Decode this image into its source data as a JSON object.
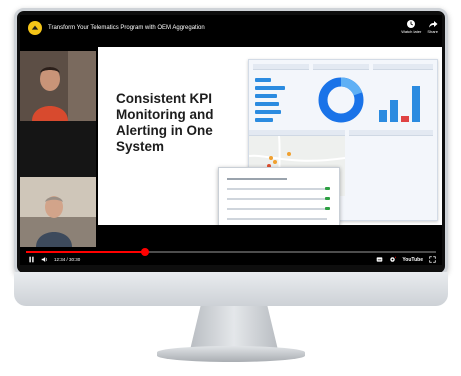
{
  "video": {
    "title": "Transform Your Telematics Program with OEM Aggregation",
    "time_current": "12:34",
    "time_total": "30:30",
    "progress_fraction": 0.29
  },
  "top_actions": [
    {
      "icon": "clock-icon",
      "label": "Watch later"
    },
    {
      "icon": "share-icon",
      "label": "Share"
    }
  ],
  "slide": {
    "heading": "Consistent KPI Monitoring and Alerting in One System"
  },
  "controls": {
    "youtube_label": "YouTube"
  },
  "colors": {
    "progress": "#ff0000",
    "accent": "#2b8be0",
    "channel": "#f5c518"
  }
}
